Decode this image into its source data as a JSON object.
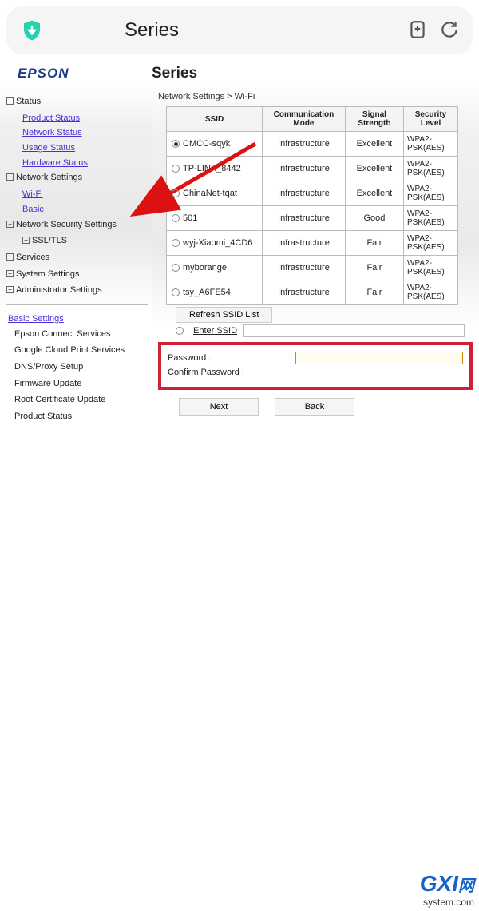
{
  "browser": {
    "title": "Series"
  },
  "header": {
    "logo": "EPSON",
    "series": "Series"
  },
  "sidebar": {
    "status": "Status",
    "product_status": "Product Status",
    "network_status": "Network Status",
    "usage_status": "Usage Status",
    "hardware_status": "Hardware Status",
    "network_settings": "Network Settings",
    "wifi": "Wi-Fi",
    "basic": "Basic",
    "network_security": "Network Security Settings",
    "ssl_tls": "SSL/TLS",
    "services": "Services",
    "system_settings": "System Settings",
    "admin_settings": "Administrator Settings",
    "basic_settings": "Basic Settings",
    "epson_connect": "Epson Connect Services",
    "google_cloud": "Google Cloud Print Services",
    "dns_proxy": "DNS/Proxy Setup",
    "firmware": "Firmware Update",
    "root_cert": "Root Certificate Update",
    "product_status2": "Product Status"
  },
  "main": {
    "breadcrumb": "Network Settings > Wi-Fi",
    "headers": {
      "ssid": "SSID",
      "comm": "Communication Mode",
      "signal": "Signal Strength",
      "security": "Security Level"
    },
    "rows": [
      {
        "ssid": "CMCC-sqyk",
        "mode": "Infrastructure",
        "signal": "Excellent",
        "security": "WPA2-PSK(AES)",
        "selected": true
      },
      {
        "ssid": "TP-LINK_8442",
        "mode": "Infrastructure",
        "signal": "Excellent",
        "security": "WPA2-PSK(AES)",
        "selected": false
      },
      {
        "ssid": "ChinaNet-tqat",
        "mode": "Infrastructure",
        "signal": "Excellent",
        "security": "WPA2-PSK(AES)",
        "selected": false
      },
      {
        "ssid": "501",
        "mode": "Infrastructure",
        "signal": "Good",
        "security": "WPA2-PSK(AES)",
        "selected": false
      },
      {
        "ssid": "wyj-Xiaomi_4CD6",
        "mode": "Infrastructure",
        "signal": "Fair",
        "security": "WPA2-PSK(AES)",
        "selected": false
      },
      {
        "ssid": "myborange",
        "mode": "Infrastructure",
        "signal": "Fair",
        "security": "WPA2-PSK(AES)",
        "selected": false
      },
      {
        "ssid": "tsy_A6FE54",
        "mode": "Infrastructure",
        "signal": "Fair",
        "security": "WPA2-PSK(AES)",
        "selected": false
      }
    ],
    "refresh": "Refresh SSID List",
    "enter_ssid": "Enter SSID",
    "password_label": "Password :",
    "confirm_label": "Confirm Password :",
    "password_value": "",
    "confirm_value": "",
    "next": "Next",
    "back": "Back"
  },
  "watermark": {
    "brand": "GXI",
    "wang": "网",
    "site": "system.com"
  }
}
